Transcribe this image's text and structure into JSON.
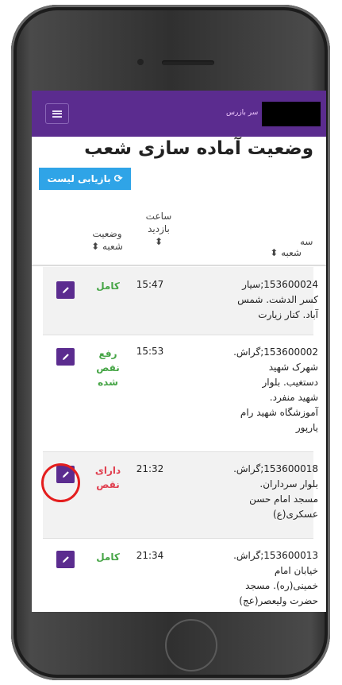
{
  "header": {
    "brand_text": "سر بازرس",
    "menu_icon": "hamburger-icon"
  },
  "page": {
    "title": "وضعیت آماده سازی شعب",
    "reload_label": "بازیابی لیست",
    "reload_icon": "refresh-icon"
  },
  "table": {
    "columns": {
      "partial": "سه",
      "branch": "شعبه ⬍",
      "visit_time_1": "ساعت",
      "visit_time_2": "بازدید",
      "visit_time_sort": "⬍",
      "status_1": "وضعیت",
      "status_2": "شعبه ⬍"
    },
    "rows": [
      {
        "branch_lines": [
          "153600024;سیار",
          "کسر الدشت. شمس",
          "آباد. کنار زیارت"
        ],
        "time": "15:47",
        "status_lines": [
          "کامل"
        ],
        "status_kind": "ok"
      },
      {
        "branch_lines": [
          "153600002;گراش.",
          "شهرک شهید",
          "دستغیب. بلوار",
          "شهید منفرد.",
          "آموزشگاه شهید رام",
          "یارپور"
        ],
        "time": "15:53",
        "status_lines": [
          "رفع",
          "نقص",
          "شده"
        ],
        "status_kind": "ok"
      },
      {
        "branch_lines": [
          "153600018;گراش.",
          "بلوار سرداران.",
          "مسجد امام حسن",
          "عسکری(ع)"
        ],
        "time": "21:32",
        "status_lines": [
          "دارای",
          "نقص"
        ],
        "status_kind": "bad"
      },
      {
        "branch_lines": [
          "153600013;گراش.",
          "خیابان امام",
          "خمینی(ره). مسجد",
          "حضرت ولیعصر(عج)"
        ],
        "time": "21:34",
        "status_lines": [
          "کامل"
        ],
        "status_kind": "ok"
      }
    ]
  },
  "colors": {
    "navbar": "#5b2c8f",
    "reload_button": "#2fa4e7",
    "status_ok": "#46a546",
    "status_bad": "#e04050",
    "annotation": "#e41e1e"
  }
}
